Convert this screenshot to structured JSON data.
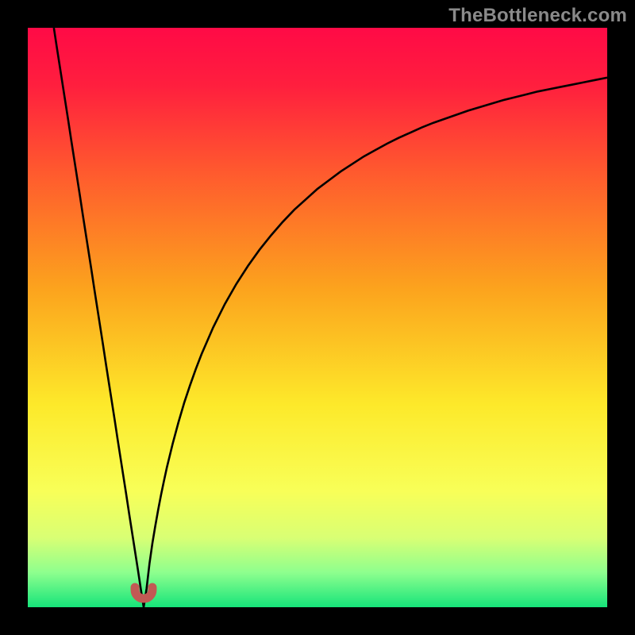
{
  "watermark": "TheBottleneck.com",
  "colors": {
    "gradient_stops": [
      {
        "offset": 0.0,
        "color": "#ff0a46"
      },
      {
        "offset": 0.1,
        "color": "#ff1f3e"
      },
      {
        "offset": 0.25,
        "color": "#ff5a2e"
      },
      {
        "offset": 0.45,
        "color": "#fca31d"
      },
      {
        "offset": 0.65,
        "color": "#fde92a"
      },
      {
        "offset": 0.8,
        "color": "#f8ff58"
      },
      {
        "offset": 0.88,
        "color": "#d9ff74"
      },
      {
        "offset": 0.94,
        "color": "#8eff8e"
      },
      {
        "offset": 1.0,
        "color": "#16e47a"
      }
    ],
    "curve": "#000000",
    "trough": "#c25a54",
    "frame": "#000000"
  },
  "chart_data": {
    "type": "line",
    "title": "",
    "xlabel": "",
    "ylabel": "",
    "xlim": [
      0,
      1
    ],
    "ylim": [
      0,
      1
    ],
    "x_min_point": 0.2,
    "series": [
      {
        "name": "bottleneck-curve",
        "x": [
          0.045,
          0.05,
          0.055,
          0.06,
          0.065,
          0.07,
          0.075,
          0.08,
          0.085,
          0.09,
          0.095,
          0.1,
          0.105,
          0.11,
          0.115,
          0.12,
          0.125,
          0.13,
          0.135,
          0.14,
          0.145,
          0.15,
          0.155,
          0.16,
          0.165,
          0.17,
          0.175,
          0.18,
          0.185,
          0.19,
          0.195,
          0.2,
          0.205,
          0.21,
          0.215,
          0.22,
          0.225,
          0.23,
          0.235,
          0.24,
          0.25,
          0.26,
          0.27,
          0.28,
          0.29,
          0.3,
          0.32,
          0.34,
          0.36,
          0.38,
          0.4,
          0.42,
          0.44,
          0.46,
          0.48,
          0.5,
          0.52,
          0.54,
          0.56,
          0.58,
          0.6,
          0.62,
          0.64,
          0.66,
          0.68,
          0.7,
          0.72,
          0.74,
          0.76,
          0.78,
          0.8,
          0.82,
          0.84,
          0.86,
          0.88,
          0.9,
          0.92,
          0.94,
          0.96,
          0.98,
          1.0
        ],
        "values_normalized_0_top_1_bottom": [
          0.0,
          0.033,
          0.065,
          0.097,
          0.129,
          0.161,
          0.194,
          0.226,
          0.258,
          0.29,
          0.323,
          0.355,
          0.387,
          0.419,
          0.452,
          0.484,
          0.516,
          0.548,
          0.581,
          0.613,
          0.645,
          0.677,
          0.71,
          0.742,
          0.774,
          0.806,
          0.839,
          0.871,
          0.903,
          0.935,
          0.968,
          1.0,
          0.968,
          0.925,
          0.89,
          0.86,
          0.832,
          0.806,
          0.782,
          0.759,
          0.718,
          0.681,
          0.647,
          0.617,
          0.589,
          0.563,
          0.517,
          0.477,
          0.442,
          0.411,
          0.383,
          0.358,
          0.335,
          0.314,
          0.296,
          0.278,
          0.263,
          0.248,
          0.235,
          0.222,
          0.211,
          0.2,
          0.19,
          0.181,
          0.172,
          0.164,
          0.157,
          0.15,
          0.143,
          0.137,
          0.131,
          0.125,
          0.12,
          0.115,
          0.11,
          0.106,
          0.102,
          0.098,
          0.094,
          0.09,
          0.086
        ]
      }
    ],
    "trough_marker": {
      "x_range": [
        0.185,
        0.215
      ],
      "y_normalized": 0.985
    }
  }
}
